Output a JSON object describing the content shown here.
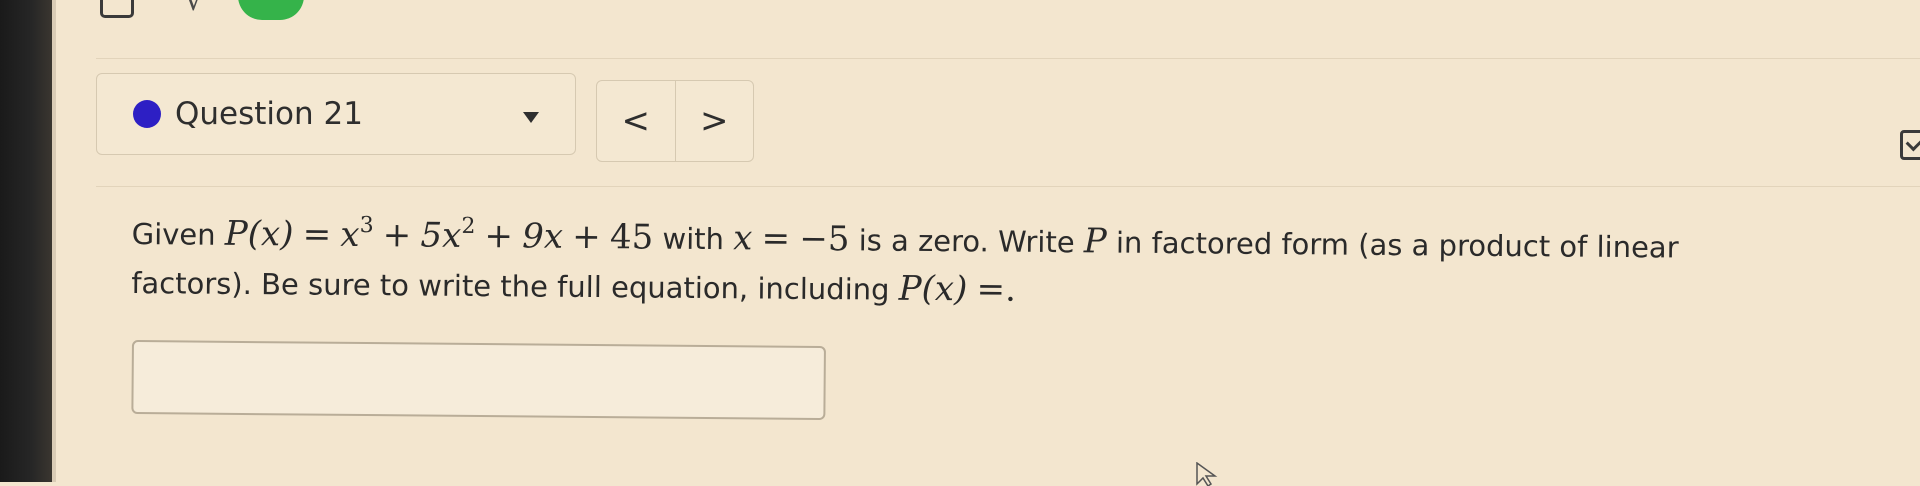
{
  "question_selector": {
    "label": "Question 21",
    "status_color": "#2d1fc4"
  },
  "nav": {
    "prev_label": "<",
    "next_label": ">"
  },
  "question": {
    "given": "Given",
    "p_of_x": "P(x)",
    "equals": "=",
    "x": "x",
    "exp3": "3",
    "plus1": "+",
    "term_5x": "5x",
    "exp2": "2",
    "plus2": "+",
    "term_9x": "9x",
    "plus3": "+",
    "const_45": "45",
    "with": "with",
    "x_var": "x",
    "equals2": "=",
    "zero_value": "−5",
    "text_after_zero": "is a zero. Write",
    "p_var": "P",
    "text_factored": "in factored form (as a product of linear factors). Be sure to write the full equation, including",
    "p_of_x_end": "P(x)",
    "end_equals": "=."
  },
  "answer_input": {
    "value": ""
  },
  "icons": {
    "top_left": "calculator-icon",
    "top_sqrt": "sqrt-icon",
    "top_toggle": "toggle-switch",
    "right_edge": "checkbox-icon",
    "cursor": "mouse-cursor-icon"
  }
}
